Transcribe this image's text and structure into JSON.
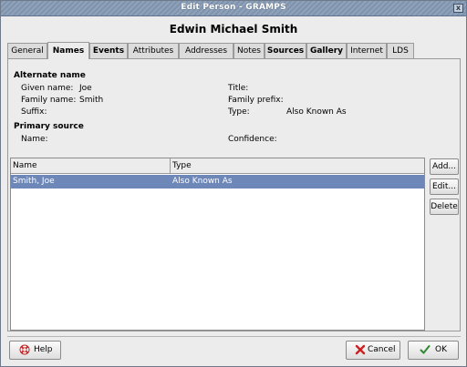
{
  "window": {
    "title": "Edit Person - GRAMPS",
    "close_label": "x"
  },
  "heading": "Edwin Michael Smith",
  "tabs": [
    {
      "label": "General"
    },
    {
      "label": "Names"
    },
    {
      "label": "Events"
    },
    {
      "label": "Attributes"
    },
    {
      "label": "Addresses"
    },
    {
      "label": "Notes"
    },
    {
      "label": "Sources"
    },
    {
      "label": "Gallery"
    },
    {
      "label": "Internet"
    },
    {
      "label": "LDS"
    }
  ],
  "active_tab": "Names",
  "alternate_name": {
    "section_title": "Alternate name",
    "given_name_label": "Given name:",
    "given_name": "Joe",
    "family_name_label": "Family name:",
    "family_name": "Smith",
    "suffix_label": "Suffix:",
    "title_label": "Title:",
    "family_prefix_label": "Family prefix:",
    "type_label": "Type:",
    "type": "Also Known As"
  },
  "primary_source": {
    "section_title": "Primary source",
    "name_label": "Name:",
    "confidence_label": "Confidence:"
  },
  "list": {
    "columns": [
      "Name",
      "Type"
    ],
    "rows": [
      {
        "name": "Smith, Joe",
        "type": "Also Known As",
        "selected": true
      }
    ]
  },
  "side_buttons": {
    "add": "Add...",
    "edit": "Edit...",
    "delete": "Delete"
  },
  "bottom_buttons": {
    "help": "Help",
    "cancel": "Cancel",
    "ok": "OK"
  },
  "colors": {
    "selection": "#6d87b8",
    "titlebar": "#7f93ad"
  }
}
